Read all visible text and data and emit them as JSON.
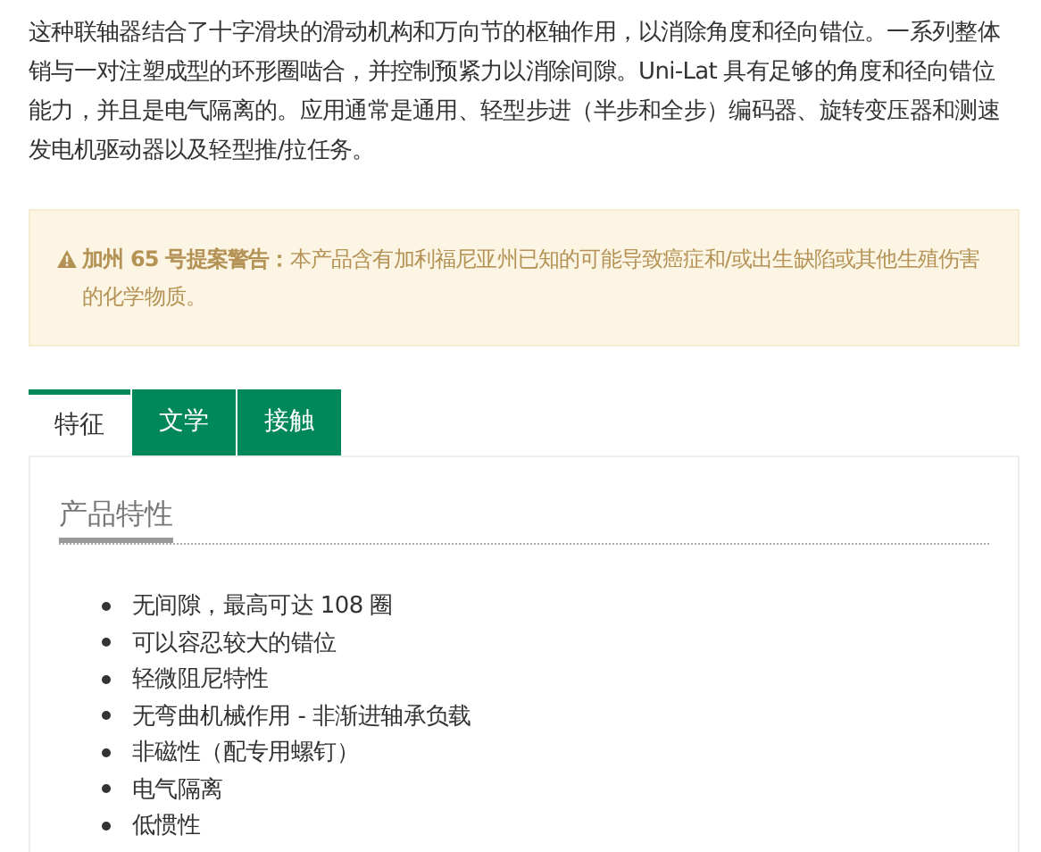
{
  "description": "这种联轴器结合了十字滑块的滑动机构和万向节的枢轴作用，以消除角度和径向错位。一系列整体销与一对注塑成型的环形圈啮合，并控制预紧力以消除间隙。Uni-Lat 具有足够的角度和径向错位能力，并且是电气隔离的。应用通常是通用、轻型步进（半步和全步）编码器、旋转变压器和测速发电机驱动器以及轻型推/拉任务。",
  "warning": {
    "text": "**加州 65 号提案警告：**本产品含有加利福尼亚州已知的可能导致癌症和/或出生缺陷或其他生殖伤害的化学物质。"
  },
  "tabs": [
    {
      "label": "特征",
      "selected": true
    },
    {
      "label": "文学",
      "selected": false
    },
    {
      "label": "接触",
      "selected": false
    }
  ],
  "panel": {
    "heading": "产品特性",
    "features": [
      "无间隙，最高可达 108 圈",
      "可以容忍较大的错位",
      "轻微阻尼特性",
      "无弯曲机械作用 - 非渐进轴承负载",
      "非磁性（配专用螺钉）",
      "电气隔离",
      "低惯性"
    ]
  }
}
